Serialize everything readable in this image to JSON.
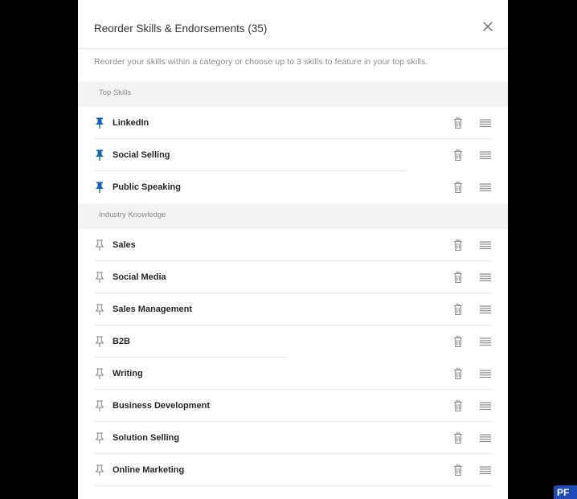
{
  "modal": {
    "title": "Reorder Skills & Endorsements (35)",
    "subtitle": "Reorder your skills within a category or choose up to 3 skills to feature in your top skills.",
    "close_icon": "close-icon"
  },
  "colors": {
    "pinned": "#0a66c2",
    "unpinned": "#8a8a8a",
    "section_bg": "#f3f3f3",
    "icon_gray": "#8a8a8a"
  },
  "sections": [
    {
      "label": "Top Skills",
      "skills": [
        {
          "name": "LinkedIn",
          "pinned": true
        },
        {
          "name": "Social Selling",
          "pinned": true
        },
        {
          "name": "Public Speaking",
          "pinned": true
        }
      ]
    },
    {
      "label": "Industry Knowledge",
      "skills": [
        {
          "name": "Sales",
          "pinned": false
        },
        {
          "name": "Social Media",
          "pinned": false
        },
        {
          "name": "Sales Management",
          "pinned": false
        },
        {
          "name": "B2B",
          "pinned": false
        },
        {
          "name": "Writing",
          "pinned": false
        },
        {
          "name": "Business Development",
          "pinned": false
        },
        {
          "name": "Solution Selling",
          "pinned": false
        },
        {
          "name": "Online Marketing",
          "pinned": false
        }
      ]
    }
  ],
  "badge": {
    "text": "PF"
  }
}
